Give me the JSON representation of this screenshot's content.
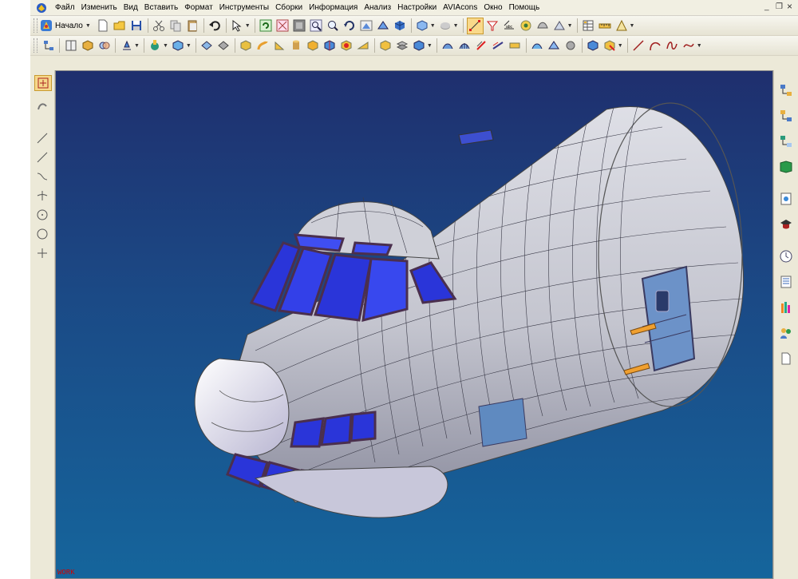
{
  "menu": {
    "items": [
      "Файл",
      "Изменить",
      "Вид",
      "Вставить",
      "Формат",
      "Инструменты",
      "Сборки",
      "Информация",
      "Анализ",
      "Настройки",
      "AVIAcons",
      "Окно",
      "Помощь"
    ]
  },
  "window_controls": {
    "minimize": "_",
    "restore": "❐",
    "close": "×"
  },
  "toolbar": {
    "start_label": "Начало",
    "row1_icons": [
      "new-icon",
      "open-icon",
      "save-icon",
      "cut-icon",
      "copy-icon",
      "paste-icon",
      "undo-icon",
      "select-tool-icon",
      "refresh-icon",
      "fit-icon",
      "zoom-window-icon",
      "zoom-icon",
      "rotate-icon",
      "view-icon",
      "shaded-icon",
      "render-style-icon",
      "paint-icon",
      "snap-icon",
      "selection-filter-icon",
      "measure-icon",
      "analysis-icon",
      "shape-icon",
      "table-icon",
      "ruler-icon",
      "section-icon"
    ],
    "row2_icons": [
      "tree-icon",
      "book-icon",
      "part-icon",
      "assembly-icon",
      "align-icon",
      "component-icon",
      "box-icon",
      "solid-icon",
      "extrude-icon",
      "revolve-icon",
      "sweep-icon",
      "block-icon",
      "cylinder-icon",
      "cone-icon",
      "sphere-icon",
      "boolean-icon",
      "blend-icon",
      "chamfer-icon",
      "shell-icon",
      "trim-icon",
      "surface-icon",
      "mesh-icon",
      "offset-icon",
      "sew-icon",
      "thicken-icon",
      "patch-icon",
      "wrap-icon",
      "unite-icon",
      "subtract-icon",
      "intersect-icon",
      "line-icon",
      "arc-icon",
      "spline-icon",
      "curve-icon"
    ]
  },
  "left_panel": {
    "tools": [
      "select-icon",
      "sketch-icon",
      "line-icon",
      "polyline-icon",
      "spline-icon",
      "point-icon",
      "circle-icon",
      "ellipse-icon",
      "plus-icon"
    ]
  },
  "right_panel": {
    "tools": [
      "part-navigator-icon",
      "assembly-navigator-icon",
      "constraint-navigator-icon",
      "reuse-library-icon",
      "web-browser-icon",
      "training-icon",
      "history-icon",
      "process-studio-icon",
      "palette-icon",
      "roles-icon",
      "document-icon"
    ]
  },
  "viewport": {
    "footer_text": "WORK",
    "colors": {
      "bg_top": "#1f2f6e",
      "bg_bottom": "#15659c",
      "hull": "#c8c9d2",
      "window": "#2a35d9",
      "frame": "#4a2f4e"
    }
  }
}
